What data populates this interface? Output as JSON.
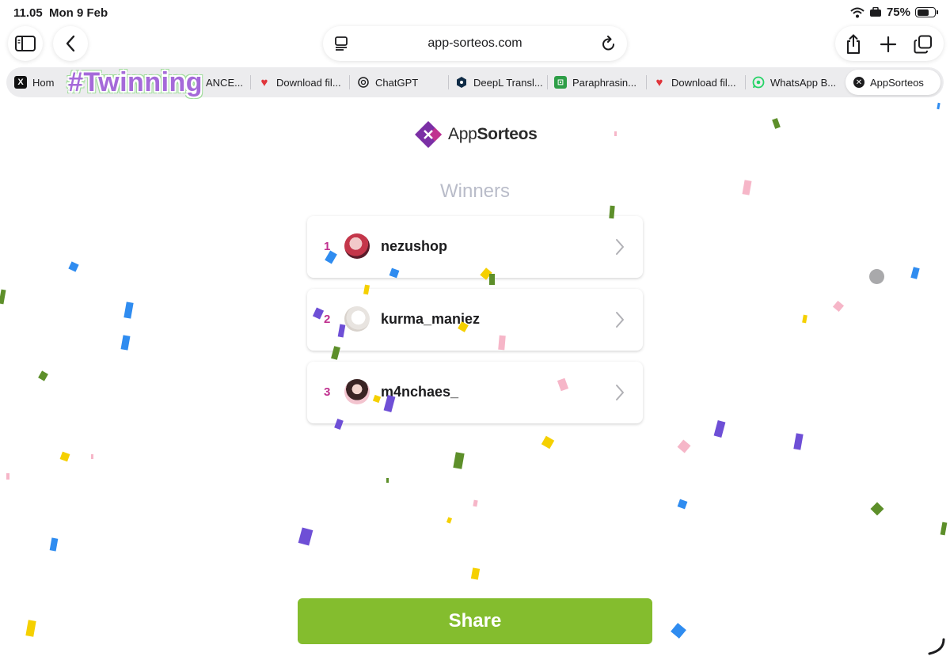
{
  "status_bar": {
    "time": "11.05",
    "date": "Mon 9 Feb",
    "battery": "75%",
    "battery_level": 0.75
  },
  "browser": {
    "url": "app-sorteos.com",
    "tabs": [
      {
        "label": "Hom",
        "icon": "x-logo-icon"
      },
      {
        "label": "ANCE...",
        "icon": "none"
      },
      {
        "label": "Download fil...",
        "icon": "heart-icon"
      },
      {
        "label": "ChatGPT",
        "icon": "chatgpt-icon"
      },
      {
        "label": "DeepL Transl...",
        "icon": "deepl-icon"
      },
      {
        "label": "Paraphrasin...",
        "icon": "robot-icon"
      },
      {
        "label": "Download fil...",
        "icon": "heart-icon"
      },
      {
        "label": "WhatsApp B...",
        "icon": "whatsapp-icon"
      },
      {
        "label": "AppSorteos",
        "icon": "close-icon"
      }
    ]
  },
  "overlay": {
    "sticker_text": "#Twinning"
  },
  "page": {
    "logo": {
      "prefix": "App",
      "suffix": "Sorteos"
    },
    "heading": "Winners",
    "winners": [
      {
        "rank": "1",
        "username": "nezushop"
      },
      {
        "rank": "2",
        "username": "kurma_maniez"
      },
      {
        "rank": "3",
        "username": "m4nchaes_"
      }
    ],
    "share_label": "Share"
  },
  "colors": {
    "accent_green": "#84bd2e",
    "rank_magenta": "#c0318f",
    "heading_gray": "#b9bcc9",
    "logo_purple": "#7b2fa5"
  }
}
